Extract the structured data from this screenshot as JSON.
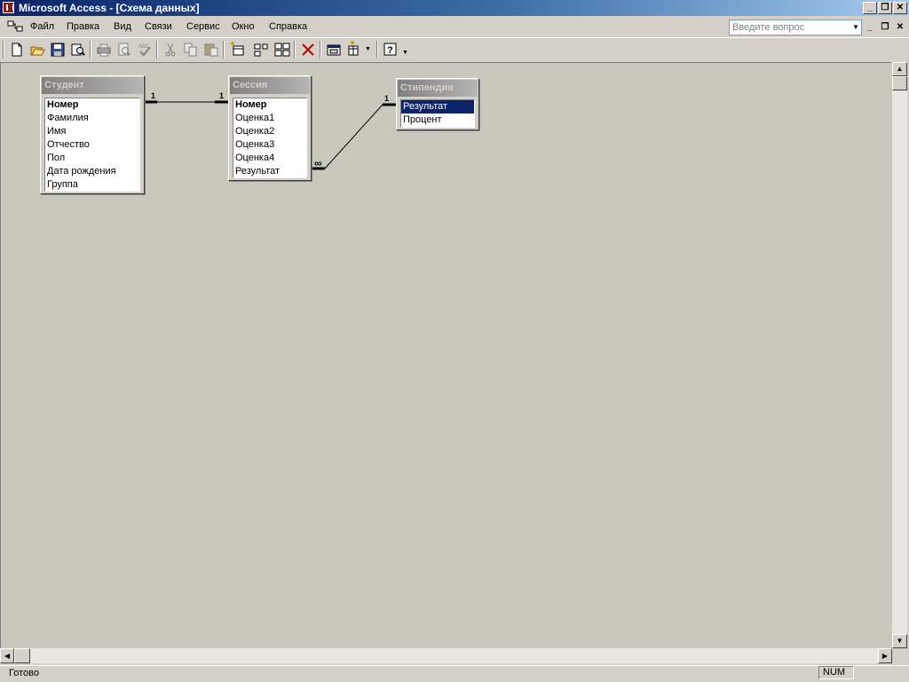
{
  "window": {
    "title": "Microsoft Access - [Схема данных]"
  },
  "menu": {
    "items": [
      {
        "label": "Файл"
      },
      {
        "label": "Правка"
      },
      {
        "label": "Вид"
      },
      {
        "label": "Связи"
      },
      {
        "label": "Сервис"
      },
      {
        "label": "Окно"
      },
      {
        "label": "Справка"
      }
    ],
    "ask_placeholder": "Введите вопрос"
  },
  "toolbar": {
    "buttons": [
      "new-icon",
      "open-icon",
      "save-icon",
      "search-file-icon",
      "print-icon",
      "print-preview-icon",
      "spelling-icon",
      "cut-icon",
      "copy-icon",
      "paste-icon",
      "show-table-icon",
      "show-direct-icon",
      "show-all-icon",
      "delete-icon",
      "database-window-icon",
      "new-object-icon",
      "help-icon"
    ]
  },
  "schema": {
    "tables": [
      {
        "name": "Студент",
        "fields": [
          "Номер",
          "Фамилия",
          "Имя",
          "Отчество",
          "Пол",
          "Дата рождения",
          "Группа"
        ],
        "key": "Номер"
      },
      {
        "name": "Сессия",
        "fields": [
          "Номер",
          "Оценка1",
          "Оценка2",
          "Оценка3",
          "Оценка4",
          "Результат"
        ],
        "key": "Номер"
      },
      {
        "name": "Стипендия",
        "fields": [
          "Результат",
          "Процент"
        ],
        "selected": "Результат"
      }
    ],
    "relations": [
      {
        "from": "Студент.Номер",
        "to": "Сессия.Номер",
        "from_label": "1",
        "to_label": "1"
      },
      {
        "from": "Сессия.Результат",
        "to": "Стипендия.Результат",
        "from_label": "∞",
        "to_label": "1"
      }
    ]
  },
  "status": {
    "text": "Готово",
    "num": "NUM"
  },
  "colors": {
    "title_start": "#0a246a",
    "title_end": "#a6caf0",
    "workspace": "#c8c8bc",
    "selection": "#0a246a"
  }
}
